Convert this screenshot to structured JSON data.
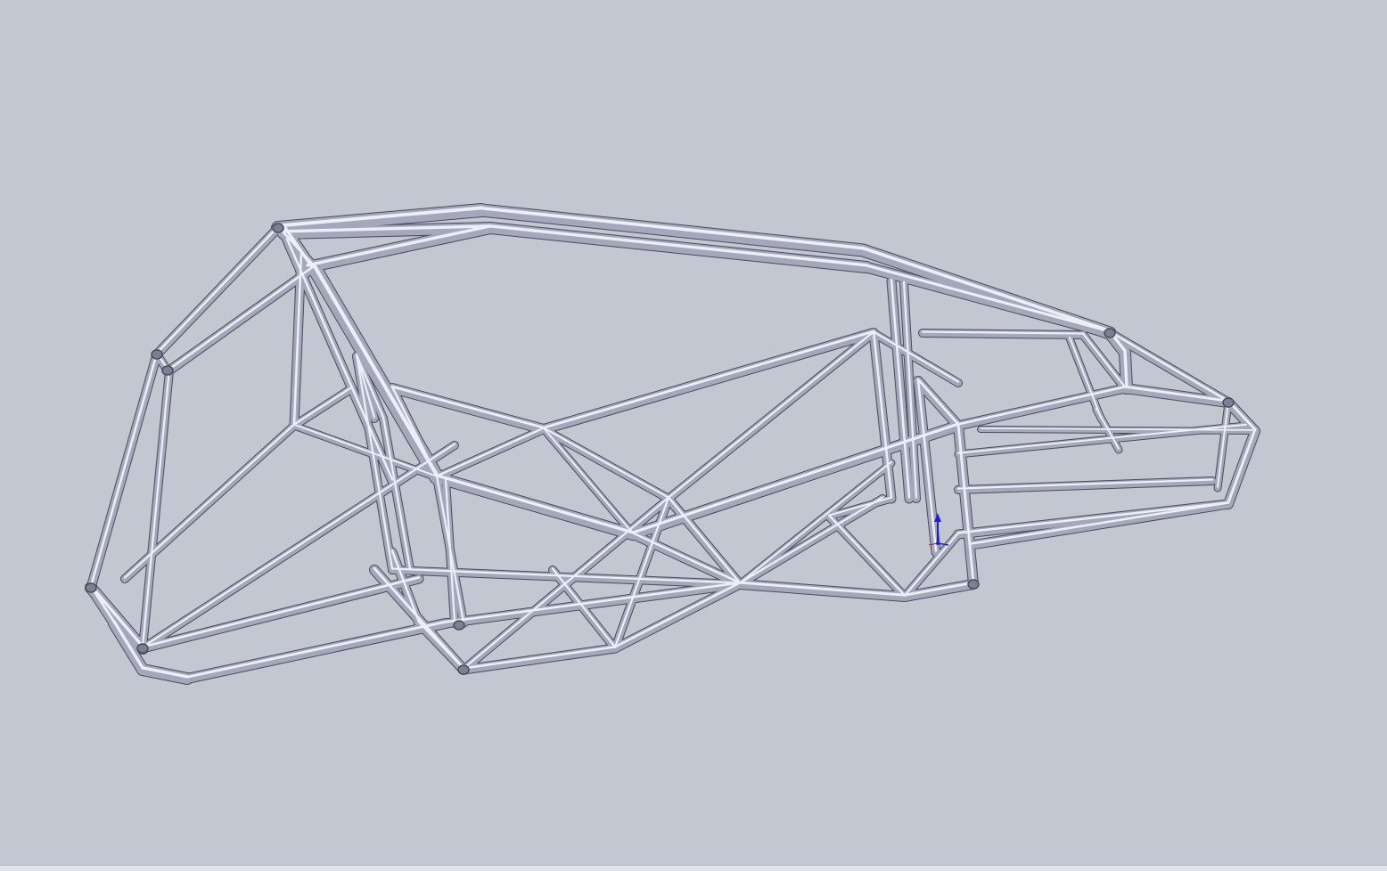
{
  "viewport": {
    "background": "#c3c7d2",
    "model": "tube-frame-chassis"
  },
  "colors": {
    "tube_outline": "#4a4c57",
    "tube_body": "#a5a8bb",
    "tube_highlight": "#eceef8",
    "triad_z": "#1a22d8",
    "triad_x": "#c01818"
  },
  "icons": {
    "origin_triad": "origin-triad-icon"
  }
}
